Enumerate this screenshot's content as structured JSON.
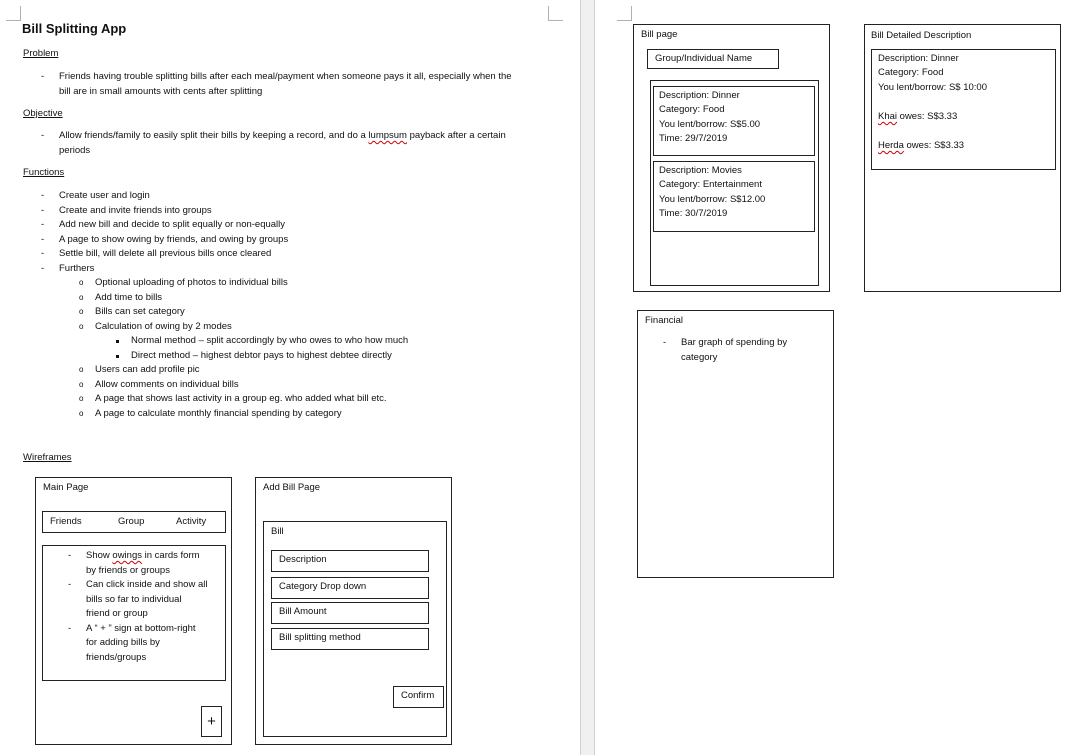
{
  "doc": {
    "title": "Bill Splitting App",
    "problem": {
      "heading": "Problem",
      "items": [
        "Friends having trouble splitting bills after each meal/payment when someone pays it all, especially when the",
        "bill are in small amounts with cents after splitting"
      ]
    },
    "objective": {
      "heading": "Objective",
      "line1_a": "Allow friends/family to easily split their bills by keeping a record, and do a ",
      "line1_b": "lumpsum",
      "line1_c": " payback after a certain",
      "line2": "periods"
    },
    "functions": {
      "heading": "Functions",
      "items": [
        "Create user and login",
        "Create and invite friends into groups",
        "Add new bill and decide to split equally or non-equally",
        "A page to show owing by friends, and owing by groups",
        "Settle bill, will delete all previous bills once cleared",
        "Furthers"
      ],
      "furthers": [
        "Optional uploading of photos to individual bills",
        "Add time to bills",
        "Bills can set category",
        "Calculation of owing by 2 modes"
      ],
      "modes": [
        "Normal method – split accordingly by who owes to who how much",
        "Direct method – highest debtor pays to highest debtee directly"
      ],
      "furthers2": [
        "Users can add profile pic",
        "Allow comments on individual bills",
        "A page that shows last activity in a group eg. who added what bill etc.",
        "A page to calculate monthly financial spending by category"
      ]
    },
    "wireframes_heading": "Wireframes"
  },
  "main_page": {
    "title": "Main Page",
    "tabs": [
      "Friends",
      "Group",
      "Activity"
    ],
    "bullets": [
      [
        "Show owings in cards form",
        "by friends or groups"
      ],
      [
        "Can click inside and show all",
        "bills so far to individual",
        "friend or group"
      ],
      [
        "A “ + ” sign at bottom-right",
        "for adding bills by",
        "friends/groups"
      ]
    ],
    "plus": "+"
  },
  "add_bill": {
    "title": "Add Bill Page",
    "section": "Bill",
    "fields": [
      "Description",
      "Category Drop down",
      "Bill Amount",
      "Bill splitting method"
    ],
    "confirm": "Confirm"
  },
  "bill_page": {
    "title": "Bill page",
    "name_box": "Group/Individual Name",
    "cards": [
      {
        "description": "Description: Dinner",
        "category": "Category: Food",
        "amount": "You lent/borrow: S$5.00",
        "time": "Time: 29/7/2019"
      },
      {
        "description": "Description: Movies",
        "category": "Category: Entertainment",
        "amount": "You lent/borrow: S$12.00",
        "time": "Time: 30/7/2019"
      }
    ]
  },
  "bill_detail": {
    "title": "Bill Detailed Description",
    "description": "Description: Dinner",
    "category": "Category: Food",
    "amount": "You lent/borrow: S$ 10:00",
    "owes": [
      {
        "name": "Khai",
        "text": " owes: S$3.33"
      },
      {
        "name": "Herda",
        "text": " owes: S$3.33"
      }
    ]
  },
  "financial": {
    "title": "Financial",
    "items": [
      "Bar graph of spending by",
      "category"
    ]
  }
}
